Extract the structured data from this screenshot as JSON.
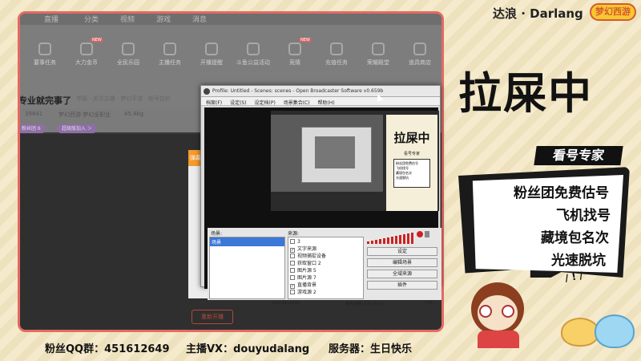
{
  "overlay": {
    "brand": "达浪 · Darlang",
    "game_logo": "梦幻西游",
    "big_title": "拉屎中",
    "tag": "看号专家",
    "bubble_lines": [
      "粉丝团免费估号",
      "飞机找号",
      "藏境包名次",
      "光速脱坑"
    ],
    "exclaim": "/ ! /"
  },
  "footer": {
    "fan_group": "粉丝QQ群：451612649",
    "anchor_vx": "主播VX：douyudalang",
    "server": "服务器：生日快乐"
  },
  "site": {
    "top_nav": [
      "直播",
      "分类",
      "视频",
      "游戏",
      "消息"
    ],
    "icons": [
      {
        "label": "要事任务",
        "new": false
      },
      {
        "label": "大力金币",
        "new": true
      },
      {
        "label": "全民乐园",
        "new": false
      },
      {
        "label": "主播任务",
        "new": false
      },
      {
        "label": "开播提醒",
        "new": false
      },
      {
        "label": "斗鱼公益活动",
        "new": false
      },
      {
        "label": "竞猜",
        "new": true
      },
      {
        "label": "充值任务",
        "new": false
      },
      {
        "label": "荣耀殿堂",
        "new": false
      },
      {
        "label": "道具商店",
        "new": false
      }
    ],
    "room_title": "专业就完事了",
    "room_sub": "举报 · 关注主播 · 梦幻手游 · 账号估价",
    "meta_left": "39841",
    "meta_tag": "梦幻西游·梦幻全职业",
    "meta_right": "45.4kg",
    "tags": [
      "粉丝团 6",
      "超级版加入 ＞"
    ],
    "panel_head": "弹幕",
    "restart": "重新开播"
  },
  "obs": {
    "title": "Profile: Untitled - Scenes: scenes - Open Broadcaster Software v0.659b",
    "menu": [
      "档案(F)",
      "设定(S)",
      "设定档(P)",
      "场景集合(C)",
      "帮助(H)"
    ],
    "preview_title": "拉屎中",
    "preview_sub": "看号专家",
    "preview_lines": [
      "粉丝团免费估号",
      "飞机找号",
      "藏境包名次",
      "光速脱坑"
    ],
    "scenes_label": "场景:",
    "scenes": [
      "场景"
    ],
    "sources_label": "来源:",
    "sources": [
      {
        "label": "3",
        "checked": false
      },
      {
        "label": "文字来源",
        "checked": true
      },
      {
        "label": "视频捕捉设备",
        "checked": false
      },
      {
        "label": "获取窗口 2",
        "checked": false
      },
      {
        "label": "图片源 5",
        "checked": false
      },
      {
        "label": "图片源 7",
        "checked": false
      },
      {
        "label": "直播背景",
        "checked": true
      },
      {
        "label": "游戏源 2",
        "checked": false
      }
    ],
    "buttons": [
      "设定",
      "编辑场景",
      "全域来源",
      "插件"
    ],
    "status_time": "0:00:01 (LIVE)",
    "status_dropped": "丢失帧数: 0 (0.00%)",
    "status_fps": "FPS"
  }
}
